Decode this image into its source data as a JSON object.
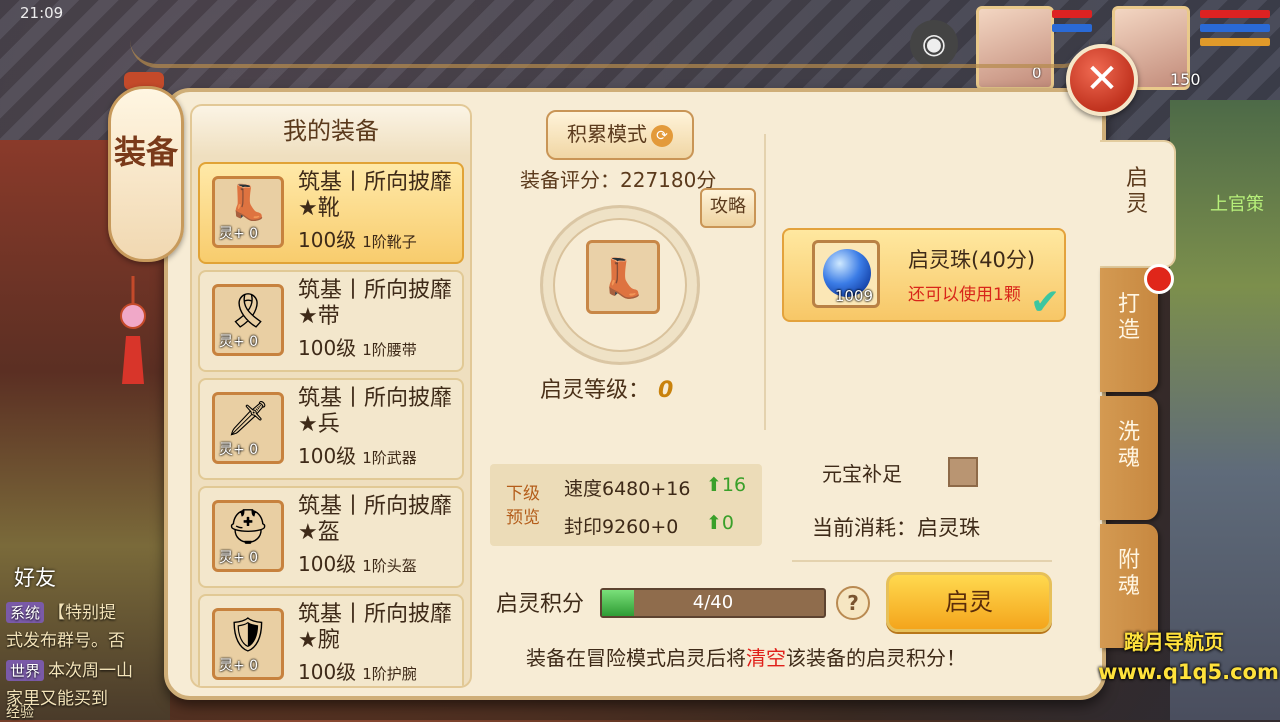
{
  "status_bar": {
    "time": "21:09"
  },
  "world": {
    "npc_name": "上官策",
    "portrait_level": "150",
    "portrait_level_left": "0"
  },
  "window": {
    "title": "装备"
  },
  "equip_list": {
    "header": "我的装备",
    "items": [
      {
        "title": "筑基丨所向披靡★靴",
        "level": "100级",
        "tier": "1阶靴子",
        "refine": "灵+ 0",
        "icon": "boots-icon",
        "selected": true
      },
      {
        "title": "筑基丨所向披靡★带",
        "level": "100级",
        "tier": "1阶腰带",
        "refine": "灵+ 0",
        "icon": "belt-icon",
        "selected": false
      },
      {
        "title": "筑基丨所向披靡★兵",
        "level": "100级",
        "tier": "1阶武器",
        "refine": "灵+ 0",
        "icon": "weapon-icon",
        "selected": false
      },
      {
        "title": "筑基丨所向披靡★盔",
        "level": "100级",
        "tier": "1阶头盔",
        "refine": "灵+ 0",
        "icon": "helmet-icon",
        "selected": false
      },
      {
        "title": "筑基丨所向披靡★腕",
        "level": "100级",
        "tier": "1阶护腕",
        "refine": "灵+ 0",
        "icon": "bracer-icon",
        "selected": false
      }
    ]
  },
  "center": {
    "mode_button": "积累模式",
    "score": "装备评分：227180分",
    "guide_button": "攻略",
    "qiling_level_label": "启灵等级：",
    "qiling_level_value": "0",
    "preview_label": "下级预览",
    "stats": [
      {
        "text": "速度6480+16",
        "up": "16"
      },
      {
        "text": "封印9260+0",
        "up": "0"
      }
    ]
  },
  "pearl": {
    "name": "启灵珠(40分)",
    "count": "1009",
    "remain": "还可以使用1颗"
  },
  "options": {
    "ingot_label": "元宝补足",
    "ingot_checked": false,
    "cost_label": "当前消耗：",
    "cost_value": "启灵珠"
  },
  "points": {
    "label": "启灵积分",
    "current": 4,
    "max": 40,
    "text": "4/40",
    "help": "?"
  },
  "action_button": "启灵",
  "note": {
    "before": "装备在冒险模式启灵后将",
    "highlight": "清空",
    "after": "该装备的启灵积分！"
  },
  "tabs": [
    {
      "label": "启灵",
      "active": true
    },
    {
      "label": "打造",
      "active": false,
      "badge": true
    },
    {
      "label": "洗魂",
      "active": false
    },
    {
      "label": "附魂",
      "active": false
    }
  ],
  "chat": {
    "friend_label": "好友",
    "lines": [
      {
        "tag": "系统",
        "text": "【特别提"
      },
      {
        "tag": "",
        "text": "式发布群号。否"
      },
      {
        "tag": "世界",
        "text": "本次周一山"
      },
      {
        "tag": "",
        "text": "家里又能买到"
      }
    ],
    "exp_label": "经验"
  },
  "watermark": {
    "line1": "踏月导航页",
    "line2": "www.q1q5.com"
  },
  "colors": {
    "accent": "#f4a51c",
    "highlight": "#e0201a",
    "progress": "#2f9c34"
  }
}
